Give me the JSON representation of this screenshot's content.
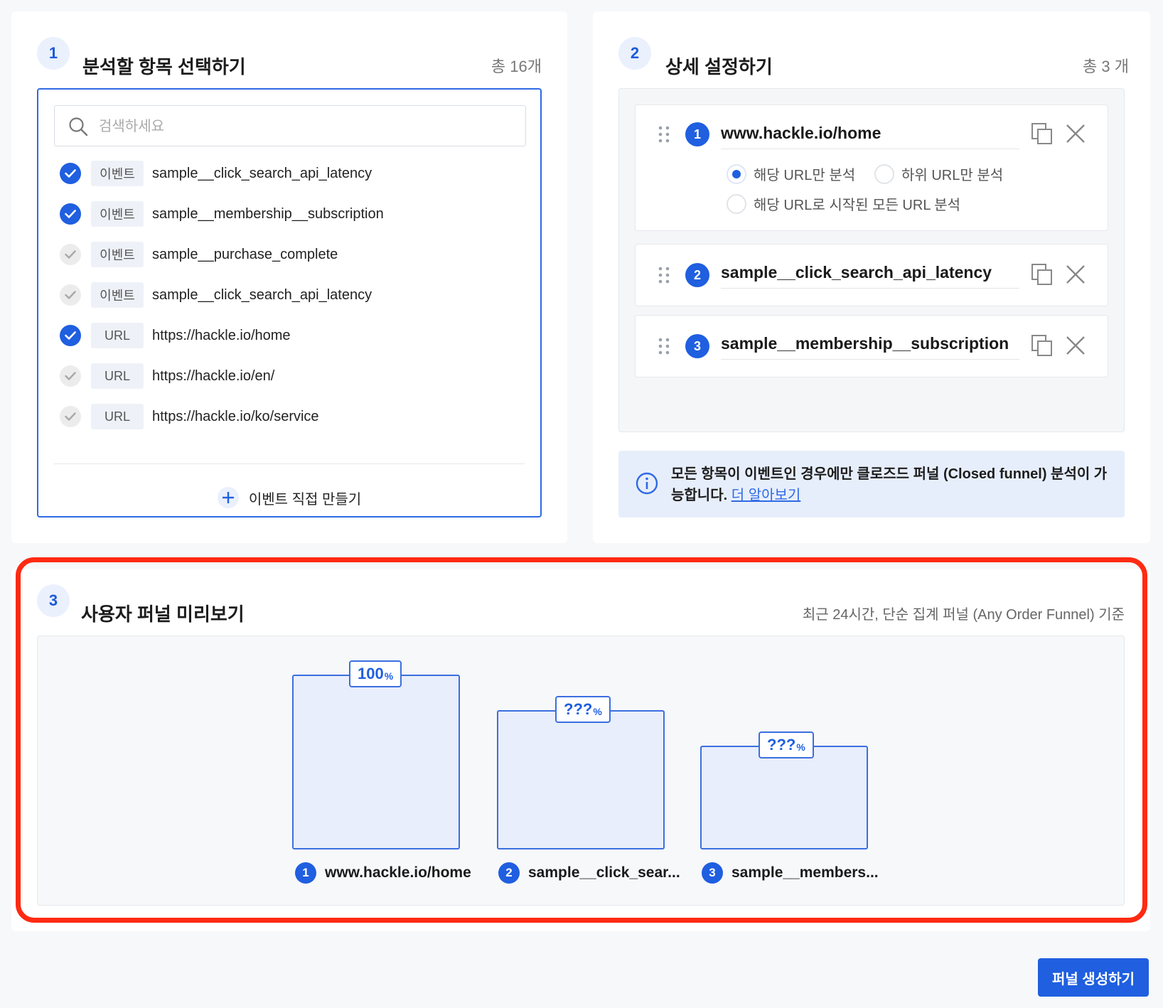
{
  "select_panel": {
    "step": "1",
    "title": "분석할 항목 선택하기",
    "count": "총 16개",
    "search_placeholder": "검색하세요",
    "items": [
      {
        "checked": true,
        "tag": "이벤트",
        "label": "sample__click_search_api_latency"
      },
      {
        "checked": true,
        "tag": "이벤트",
        "label": "sample__membership__subscription"
      },
      {
        "checked": false,
        "tag": "이벤트",
        "label": "sample__purchase_complete"
      },
      {
        "checked": false,
        "tag": "이벤트",
        "label": "sample__click_search_api_latency"
      },
      {
        "checked": true,
        "tag": "URL",
        "label": "https://hackle.io/home"
      },
      {
        "checked": false,
        "tag": "URL",
        "label": "https://hackle.io/en/"
      },
      {
        "checked": false,
        "tag": "URL",
        "label": "https://hackle.io/ko/service"
      }
    ],
    "create_event_label": "이벤트 직접 만들기"
  },
  "detail_panel": {
    "step": "2",
    "title": "상세 설정하기",
    "count": "총 3 개",
    "cards": [
      {
        "num": "1",
        "title": "www.hackle.io/home"
      },
      {
        "num": "2",
        "title": "sample__click_search_api_latency"
      },
      {
        "num": "3",
        "title": "sample__membership__subscription"
      }
    ],
    "radio_options": [
      {
        "label": "해당 URL만 분석",
        "selected": true
      },
      {
        "label": "하위 URL만 분석",
        "selected": false
      },
      {
        "label": "해당 URL로 시작된 모든 URL 분석",
        "selected": false
      }
    ],
    "info_text": "모든 항목이 이벤트인 경우에만 클로즈드 퍼널 (Closed funnel) 분석이 가능합니다.",
    "info_link": "더 알아보기"
  },
  "preview_panel": {
    "step": "3",
    "title": "사용자 퍼널 미리보기",
    "note": "최근 24시간, 단순 집계 퍼널 (Any Order Funnel) 기준",
    "bars": [
      {
        "num": "1",
        "pct": "100",
        "unit": "%",
        "label": "www.hackle.io/home"
      },
      {
        "num": "2",
        "pct": "???",
        "unit": "%",
        "label": "sample__click_sear..."
      },
      {
        "num": "3",
        "pct": "???",
        "unit": "%",
        "label": "sample__members..."
      }
    ]
  },
  "actions": {
    "create_funnel": "퍼널 생성하기"
  },
  "colors": {
    "accent": "#1f5fe0",
    "highlight": "#ff2a12"
  }
}
